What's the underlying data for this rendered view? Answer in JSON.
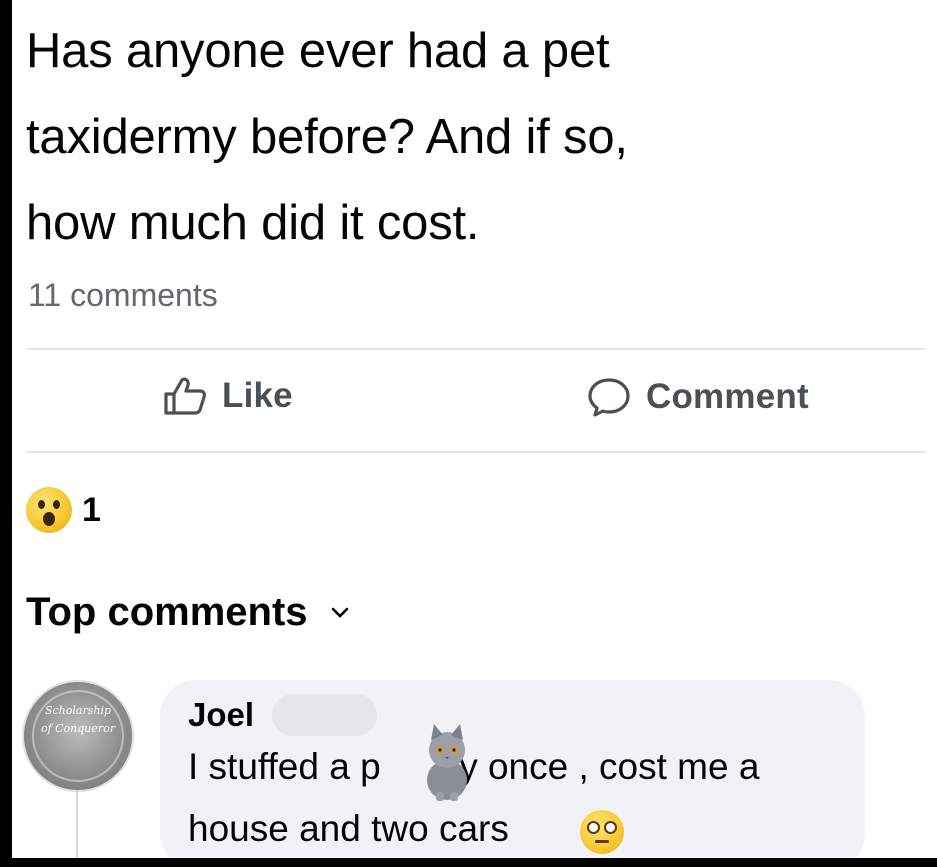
{
  "post": {
    "lines": [
      "Has anyone ever had a pet",
      "taxidermy before? And if so,",
      "how much did it cost."
    ],
    "comment_count": "11 comments"
  },
  "actions": {
    "like_label": "Like",
    "comment_label": "Comment"
  },
  "reactions": {
    "icon": "wow-icon",
    "count": "1"
  },
  "top_comments": {
    "label": "Top comments"
  },
  "comment": {
    "author": "Joel",
    "line1_start": "I stuffed a p",
    "line1_end": "sy once , cost me a",
    "line2": "house and two cars",
    "emoji": "flushed-face-icon"
  },
  "avatar": {
    "text": "Scholarship of Conqueror"
  },
  "colors": {
    "text": "#050505",
    "secondary": "#65676b",
    "bubble": "#f0f2f5",
    "divider": "#e4e6eb"
  }
}
